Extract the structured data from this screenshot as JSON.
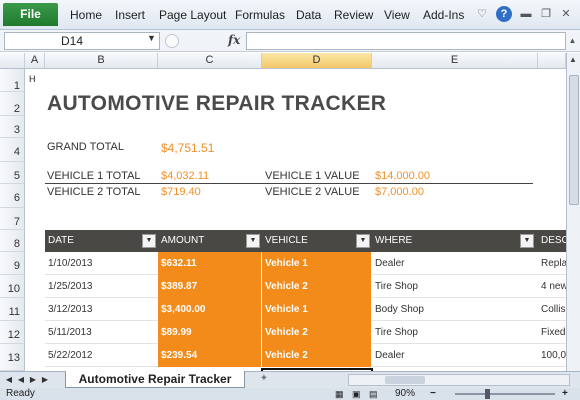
{
  "ribbon": {
    "file_label": "File",
    "tabs": [
      "Home",
      "Insert",
      "Page Layout",
      "Formulas",
      "Data",
      "Review",
      "View",
      "Add-Ins"
    ],
    "icons": [
      "heart-icon",
      "help-icon",
      "minimize-icon",
      "restore-icon",
      "close-icon"
    ],
    "help_glyph": "?"
  },
  "formula_bar": {
    "name_box": "D14",
    "fx_label": "fx",
    "formula": ""
  },
  "columns": [
    "A",
    "B",
    "C",
    "D",
    "E"
  ],
  "rows": [
    "1",
    "2",
    "3",
    "4",
    "5",
    "6",
    "7",
    "8",
    "9",
    "10",
    "11",
    "12",
    "13"
  ],
  "sheet": {
    "a1_marker": "H",
    "title": "AUTOMOTIVE REPAIR TRACKER",
    "grand_total_label": "GRAND TOTAL",
    "grand_total_value": "$4,751.51",
    "v1_total_label": "VEHICLE 1 TOTAL",
    "v1_total_value": "$4,032.11",
    "v2_total_label": "VEHICLE 2 TOTAL",
    "v2_total_value": "$719.40",
    "v1_value_label": "VEHICLE 1  VALUE",
    "v1_value_value": "$14,000.00",
    "v2_value_label": "VEHICLE 2  VALUE",
    "v2_value_value": "$7,000.00"
  },
  "table": {
    "headers": [
      "DATE",
      "AMOUNT",
      "VEHICLE",
      "WHERE",
      "DESC"
    ],
    "rows": [
      {
        "date": "1/10/2013",
        "amount": "$632.11",
        "vehicle": "Vehicle 1",
        "where": "Dealer",
        "desc": "Repla"
      },
      {
        "date": "1/25/2013",
        "amount": "$389.87",
        "vehicle": "Vehicle 2",
        "where": "Tire Shop",
        "desc": "4 new"
      },
      {
        "date": "3/12/2013",
        "amount": "$3,400.00",
        "vehicle": "Vehicle 1",
        "where": "Body Shop",
        "desc": "Collis"
      },
      {
        "date": "5/11/2013",
        "amount": "$89.99",
        "vehicle": "Vehicle 2",
        "where": "Tire Shop",
        "desc": "Fixed"
      },
      {
        "date": "5/22/2012",
        "amount": "$239.54",
        "vehicle": "Vehicle 2",
        "where": "Dealer",
        "desc": "100,0"
      }
    ]
  },
  "tabs_bar": {
    "sheet_name": "Automotive Repair Tracker"
  },
  "status": {
    "ready": "Ready",
    "zoom": "90%",
    "zoom_out": "−",
    "zoom_in": "+"
  },
  "colors": {
    "accent_orange": "#f38b1a",
    "table_header": "#494844",
    "file_tab": "#2a8a3a"
  }
}
